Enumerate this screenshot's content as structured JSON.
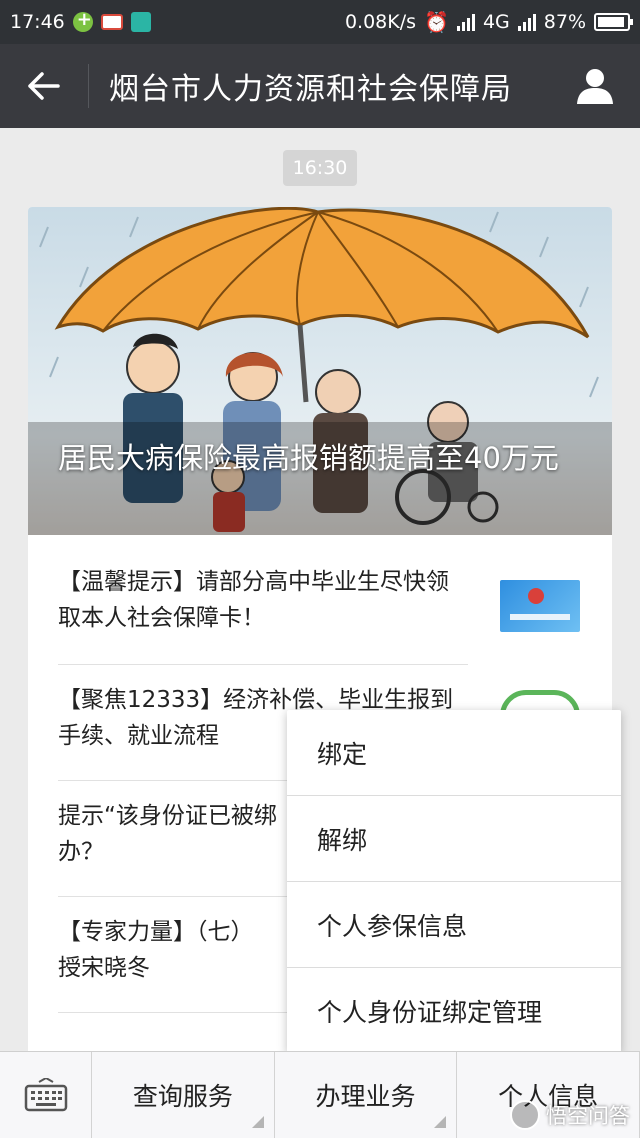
{
  "status_bar": {
    "time": "17:46",
    "network_speed": "0.08K/s",
    "network_type": "4G",
    "battery": "87%"
  },
  "title_bar": {
    "title": "烟台市人力资源和社会保障局",
    "back_icon": "arrow-left-icon",
    "profile_icon": "person-icon"
  },
  "chat": {
    "timestamp": "16:30"
  },
  "article_card": {
    "hero_title": "居民大病保险最高报销额提高至40万元",
    "items": [
      {
        "text": "【温馨提示】请部分高中毕业生尽快领取本人社会保障卡！"
      },
      {
        "text": "【聚焦12333】经济补偿、毕业生报到手续、就业流程"
      },
      {
        "text": "提示“该身份证已被绑"
      },
      {
        "line1": "办？"
      },
      {
        "text": "【专家力量】（七）"
      },
      {
        "line2": "授宋晓冬"
      }
    ]
  },
  "popup_menu": {
    "items": [
      "绑定",
      "解绑",
      "个人参保信息",
      "个人身份证绑定管理"
    ]
  },
  "bottom_bar": {
    "keyboard_icon": "keyboard-icon",
    "tabs": [
      "查询服务",
      "办理业务",
      "个人信息"
    ]
  },
  "watermark": {
    "text": "悟空问答"
  },
  "colors": {
    "status_bg": "#2f3236",
    "title_bg": "#393a3f",
    "page_bg": "#ebebeb",
    "umbrella": "#f2a23a"
  }
}
